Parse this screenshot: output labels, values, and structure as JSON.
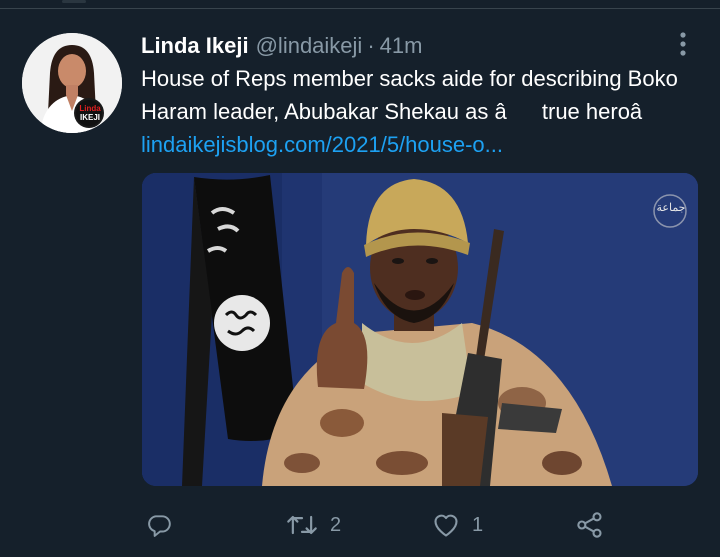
{
  "tweet": {
    "author_name": "Linda Ikeji",
    "author_handle": "@lindaikeji",
    "separator": "·",
    "timestamp": "41m",
    "text": "House of Reps member sacks aide for describing Boko Haram leader, Abubakar Shekau as âtrue heroâ ",
    "link_text": "lindaikejisblog.com/2021/5/house-o..."
  },
  "avatar": {
    "logo_text_1": "Linda",
    "logo_text_2": "IKEJI"
  },
  "media": {
    "watermark_text": "ﺟﻤﺎﻋﺔ"
  },
  "actions": {
    "reply_count": "",
    "retweet_count": "2",
    "like_count": "1"
  },
  "colors": {
    "background": "#15202b",
    "text_primary": "#ffffff",
    "text_secondary": "#8899a6",
    "link": "#1da1f2"
  },
  "icons": [
    "reply-icon",
    "retweet-icon",
    "like-icon",
    "share-icon",
    "more-icon"
  ]
}
